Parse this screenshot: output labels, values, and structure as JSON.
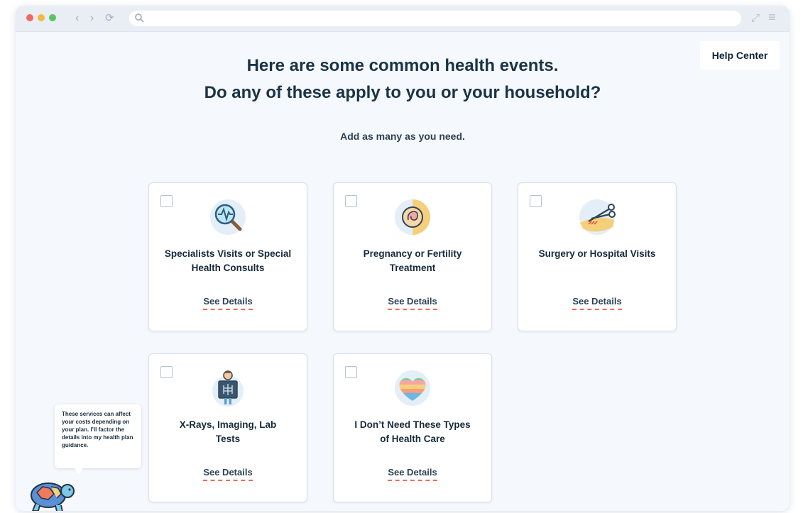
{
  "browser": {
    "nav_back": "‹",
    "nav_forward": "›",
    "nav_reload": "⟳",
    "expand_icon": "⤢",
    "menu_icon": "≡"
  },
  "header": {
    "help_center": "Help Center",
    "title_line1": "Here are some common health events.",
    "title_line2": "Do any of these apply to you or your household?",
    "subtitle": "Add as many as you need."
  },
  "cards": [
    {
      "title": "Specialists Visits or Special Health Consults",
      "details": "See Details",
      "icon": "magnifier-heartbeat-icon"
    },
    {
      "title": "Pregnancy or Fertility Treatment",
      "details": "See Details",
      "icon": "embryo-icon"
    },
    {
      "title": "Surgery or Hospital Visits",
      "details": "See Details",
      "icon": "scissors-icon"
    },
    {
      "title": "X-Rays, Imaging, Lab Tests",
      "details": "See Details",
      "icon": "xray-person-icon"
    },
    {
      "title": "I Don’t Need These Types of Health Care",
      "details": "See Details",
      "icon": "rainbow-heart-icon"
    }
  ],
  "assistant": {
    "message": "These services can affect your costs depending on your plan. I’ll factor the details into my health plan guidance.",
    "avatar": "turtle-icon"
  },
  "colors": {
    "accent_red": "#ef6b5c",
    "heading": "#1a3346",
    "window_bg": "#f5f8fc"
  }
}
